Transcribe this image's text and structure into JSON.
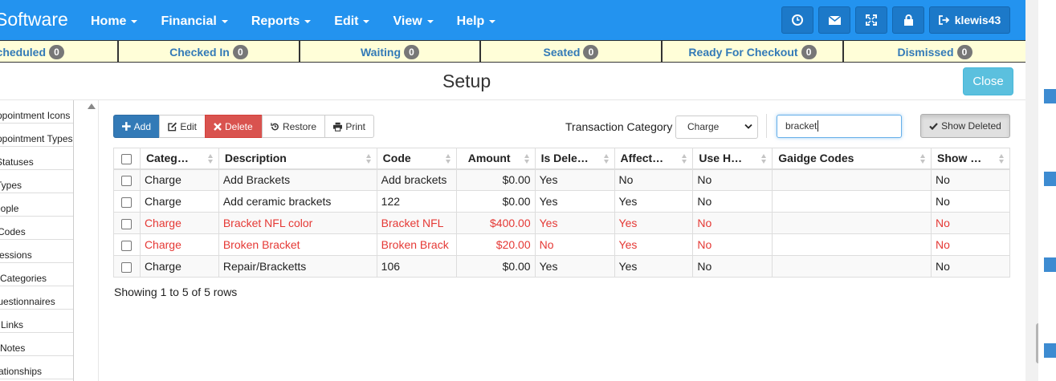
{
  "nav": {
    "brand": "Software",
    "menus": [
      {
        "label": "Home"
      },
      {
        "label": "Financial"
      },
      {
        "label": "Reports"
      },
      {
        "label": "Edit"
      },
      {
        "label": "View"
      },
      {
        "label": "Help"
      }
    ],
    "user": "klewis43",
    "icons": [
      "clock-icon",
      "envelope-icon",
      "fullscreen-icon",
      "lock-icon",
      "sign-out-icon"
    ],
    "color": "#2393ef"
  },
  "statusbar": [
    {
      "label": "Scheduled",
      "count": "0"
    },
    {
      "label": "Checked In",
      "count": "0"
    },
    {
      "label": "Waiting",
      "count": "0"
    },
    {
      "label": "Seated",
      "count": "0"
    },
    {
      "label": "Ready For Checkout",
      "count": "0"
    },
    {
      "label": "Dismissed",
      "count": "0"
    }
  ],
  "header": {
    "title": "Setup",
    "close_label": "Close"
  },
  "sidebar": {
    "items": [
      {
        "label": "Appointment Icons"
      },
      {
        "label": "Appointment Types"
      },
      {
        "label": "Statuses"
      },
      {
        "label": "Types"
      },
      {
        "label": "People"
      },
      {
        "label": "Codes"
      },
      {
        "label": "Sessions"
      },
      {
        "label": "Categories"
      },
      {
        "label": "Questionnaires"
      },
      {
        "label": "Links"
      },
      {
        "label": "Notes"
      },
      {
        "label": "Relationships"
      }
    ]
  },
  "toolbar": {
    "add": "Add",
    "edit": "Edit",
    "delete": "Delete",
    "restore": "Restore",
    "print": "Print",
    "txn_label": "Transaction Category",
    "txn_value": "Charge",
    "search_value": "bracket",
    "show_deleted": "Show Deleted"
  },
  "table": {
    "columns": [
      "Categ…",
      "Description",
      "Code",
      "Amount",
      "Is Dele…",
      "Affect…",
      "Use H…",
      "Gaidge Codes",
      "Show …"
    ],
    "rows": [
      {
        "deleted": false,
        "cells": [
          "Charge",
          "Add Brackets",
          "Add brackets",
          "$0.00",
          "Yes",
          "No",
          "No",
          "",
          "No"
        ]
      },
      {
        "deleted": false,
        "cells": [
          "Charge",
          "Add ceramic brackets",
          "122",
          "$0.00",
          "Yes",
          "Yes",
          "No",
          "",
          "No"
        ]
      },
      {
        "deleted": true,
        "cells": [
          "Charge",
          "Bracket NFL color",
          "Bracket NFL",
          "$400.00",
          "Yes",
          "Yes",
          "No",
          "",
          "No"
        ]
      },
      {
        "deleted": true,
        "cells": [
          "Charge",
          "Broken Bracket",
          "Broken Brack",
          "$20.00",
          "No",
          "Yes",
          "No",
          "",
          "No"
        ]
      },
      {
        "deleted": false,
        "cells": [
          "Charge",
          "Repair/Bracketts",
          "106",
          "$0.00",
          "Yes",
          "Yes",
          "No",
          "",
          "No"
        ]
      }
    ],
    "showing": "Showing 1 to 5 of 5 rows",
    "deleted_color": "#e53935"
  }
}
